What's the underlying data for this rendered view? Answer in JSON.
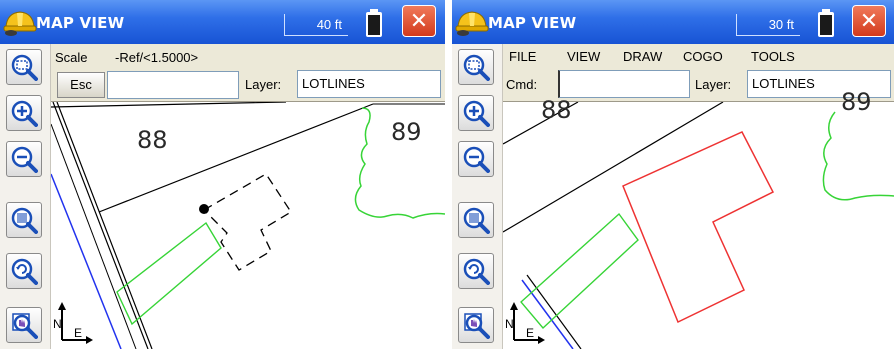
{
  "left": {
    "title": "MAP VIEW",
    "scale": "40 ft",
    "close": "✕",
    "scale_label": "Scale",
    "scale_value": "-Ref/<1.5000>",
    "esc_label": "Esc",
    "input_value": "",
    "layer_label": "Layer:",
    "layer_value": "LOTLINES",
    "lot_88": "88",
    "lot_89": "89",
    "north_label": "N",
    "east_label": "E"
  },
  "right": {
    "title": "MAP VIEW",
    "scale": "30 ft",
    "close": "✕",
    "menu": [
      "FILE",
      "VIEW",
      "DRAW",
      "COGO",
      "TOOLS"
    ],
    "cmd_label": "Cmd:",
    "cmd_value": "",
    "layer_label": "Layer:",
    "layer_value": "LOTLINES",
    "lot_88": "88",
    "lot_89": "89",
    "north_label": "N",
    "east_label": "E"
  },
  "toolbar_icons": [
    "zoom-window-icon",
    "zoom-in-icon",
    "zoom-out-icon",
    "zoom-extents-icon",
    "zoom-previous-icon",
    "pan-icon"
  ],
  "colors": {
    "titlebar": "#1f5fdc",
    "close_button": "#d94a2b",
    "lot_lines": "#000000",
    "green_lines": "#37d437",
    "blue_line": "#2233ee",
    "red_building": "#ee3333",
    "dashed_building": "#000000"
  }
}
